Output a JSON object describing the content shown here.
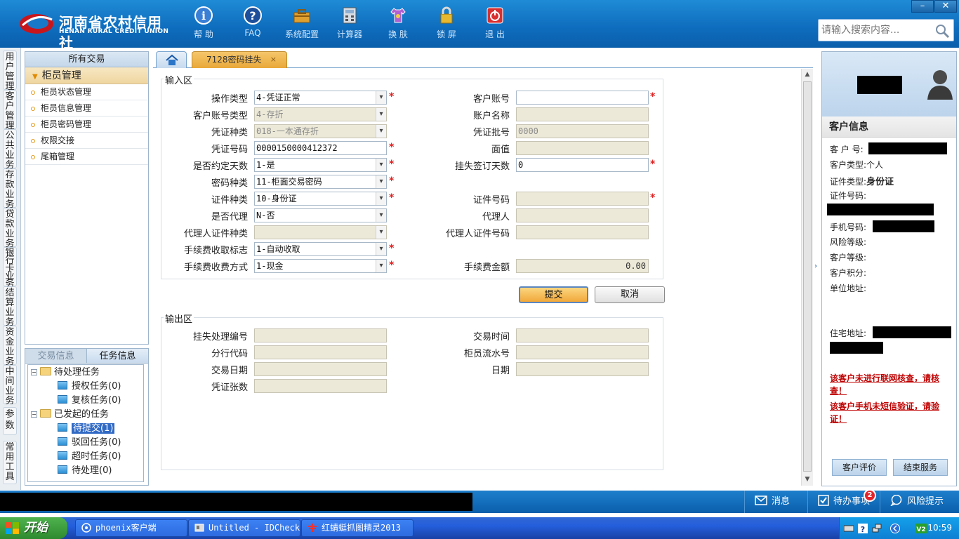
{
  "header": {
    "logo_cn": "河南省农村信用社",
    "logo_en": "HENAN RURAL CREDIT UNION",
    "toolbar": [
      {
        "label": "帮 助",
        "icon": "info-icon"
      },
      {
        "label": "FAQ",
        "icon": "question-icon"
      },
      {
        "label": "系统配置",
        "icon": "toolbox-icon"
      },
      {
        "label": "计算器",
        "icon": "calculator-icon"
      },
      {
        "label": "换 肤",
        "icon": "shirt-icon"
      },
      {
        "label": "锁 屏",
        "icon": "lock-icon"
      },
      {
        "label": "退 出",
        "icon": "power-icon"
      }
    ],
    "window_min": "–",
    "window_close": "✕",
    "search_placeholder": "请输入搜索内容..."
  },
  "vertical_tabs": [
    "用户管理",
    "客户管理",
    "公共业务",
    "存款业务",
    "贷款业务",
    "银行卡业务",
    "结算业务",
    "资金业务",
    "中间业务",
    "参数",
    "常用工具"
  ],
  "left_panel": {
    "title": "所有交易",
    "group": "柜员管理",
    "items": [
      "柜员状态管理",
      "柜员信息管理",
      "柜员密码管理",
      "权限交接",
      "尾箱管理"
    ]
  },
  "task_panel": {
    "tabs": [
      "交易信息",
      "任务信息"
    ],
    "tree": [
      {
        "label": "待处理任务",
        "level": 0,
        "type": "folder",
        "expanded": true
      },
      {
        "label": "授权任务(0)",
        "level": 1,
        "type": "leaf"
      },
      {
        "label": "复核任务(0)",
        "level": 1,
        "type": "leaf"
      },
      {
        "label": "已发起的任务",
        "level": 0,
        "type": "folder",
        "expanded": true
      },
      {
        "label": "待提交(1)",
        "level": 1,
        "type": "leaf",
        "selected": true
      },
      {
        "label": "驳回任务(0)",
        "level": 1,
        "type": "leaf"
      },
      {
        "label": "超时任务(0)",
        "level": 1,
        "type": "leaf"
      },
      {
        "label": "待处理(0)",
        "level": 1,
        "type": "leaf"
      }
    ]
  },
  "tabs": {
    "home_icon": "home-icon",
    "active": "7128密码挂失",
    "close": "×"
  },
  "input_area": {
    "legend": "输入区",
    "left": [
      {
        "label": "操作类型",
        "value": "4-凭证正常",
        "select": true,
        "required": true
      },
      {
        "label": "客户账号类型",
        "value": "4-存折",
        "select": true,
        "readonly": true
      },
      {
        "label": "凭证种类",
        "value": "018-一本通存折",
        "select": true,
        "readonly": true
      },
      {
        "label": "凭证号码",
        "value": "0000150000412372",
        "required": true
      },
      {
        "label": "是否约定天数",
        "value": "1-是",
        "select": true,
        "required": true
      },
      {
        "label": "密码种类",
        "value": "11-柜面交易密码",
        "select": true,
        "required": true
      },
      {
        "label": "证件种类",
        "value": "10-身份证",
        "select": true,
        "required": true
      },
      {
        "label": "是否代理",
        "value": "N-否",
        "select": true
      },
      {
        "label": "代理人证件种类",
        "value": "",
        "select": true,
        "readonly": true
      },
      {
        "label": "手续费收取标志",
        "value": "1-自动收取",
        "select": true,
        "required": true
      },
      {
        "label": "手续费收费方式",
        "value": "1-现金",
        "select": true,
        "required": true
      }
    ],
    "right": [
      {
        "label": "客户账号",
        "value": "",
        "blurred": true,
        "required": true
      },
      {
        "label": "账户名称",
        "value": "",
        "blurred": true,
        "readonly": true
      },
      {
        "label": "凭证批号",
        "value": "0000",
        "readonly": true
      },
      {
        "label": "面值",
        "value": "",
        "readonly": true
      },
      {
        "label": "挂失签订天数",
        "value": "0",
        "required": true
      },
      {
        "label": "",
        "value": null
      },
      {
        "label": "证件号码",
        "value": "",
        "blurred": true,
        "readonly": true,
        "required": true
      },
      {
        "label": "代理人",
        "value": "",
        "readonly": true
      },
      {
        "label": "代理人证件号码",
        "value": "",
        "readonly": true
      },
      {
        "label": "",
        "value": null
      },
      {
        "label": "手续费金额",
        "value": "0.00",
        "readonly": true,
        "numeric": true
      }
    ],
    "submit": "提交",
    "cancel": "取消"
  },
  "output_area": {
    "legend": "输出区",
    "left": [
      "挂失处理编号",
      "分行代码",
      "交易日期",
      "凭证张数"
    ],
    "right": [
      "交易时间",
      "柜员流水号",
      "日期"
    ]
  },
  "customer_panel": {
    "title": "客户信息",
    "fields": [
      {
        "label": "客 户 号:",
        "value": ""
      },
      {
        "label": "客户类型:",
        "value": "个人"
      },
      {
        "label": "证件类型:",
        "value": "身份证"
      },
      {
        "label": "证件号码:",
        "value": ""
      },
      {
        "label": "手机号码:",
        "value": ""
      },
      {
        "label": "风险等级:",
        "value": ""
      },
      {
        "label": "客户等级:",
        "value": ""
      },
      {
        "label": "客户积分:",
        "value": ""
      },
      {
        "label": "单位地址:",
        "value": ""
      },
      {
        "label": "住宅地址:",
        "value": ""
      }
    ],
    "warnings": [
      "该客户未进行联网核查，请核查！",
      "该客户手机未短信验证，请验证！"
    ],
    "buttons": [
      "客户评价",
      "结束服务"
    ]
  },
  "statusbar": {
    "items": [
      {
        "label": "消息",
        "icon": "message-icon"
      },
      {
        "label": "待办事项",
        "icon": "checkbox-icon",
        "badge": "2"
      },
      {
        "label": "风险提示",
        "icon": "chat-icon"
      }
    ]
  },
  "taskbar": {
    "start": "开始",
    "tasks": [
      "phoenix客户端",
      "Untitled - IDCheck",
      "红蜻蜓抓图精灵2013"
    ],
    "clock": "10:59"
  }
}
